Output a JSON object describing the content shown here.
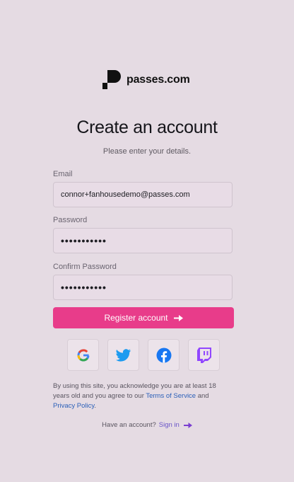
{
  "brand": {
    "name": "passes.com"
  },
  "header": {
    "title": "Create an account",
    "subtitle": "Please enter your details."
  },
  "form": {
    "email": {
      "label": "Email",
      "value": "connor+fanhousedemo@passes.com"
    },
    "password": {
      "label": "Password",
      "value": "•••••••••••"
    },
    "confirm_password": {
      "label": "Confirm Password",
      "value": "•••••••••••"
    },
    "register_label": "Register account"
  },
  "social": {
    "providers": [
      "google-icon",
      "twitter-icon",
      "facebook-icon",
      "twitch-icon"
    ]
  },
  "legal": {
    "prefix": "By using this site, you acknowledge you are at least 18 years old and you agree to our",
    "terms_link": "Terms of Service",
    "and": "and",
    "privacy_link": "Privacy Policy",
    "suffix": "."
  },
  "footer": {
    "prompt": "Have an account?",
    "signin_link": "Sign in"
  },
  "colors": {
    "background": "#e5dbe3",
    "accent": "#e83c8a",
    "link": "#2a5fb8",
    "signin_link": "#6a55c8",
    "twitter": "#1d9bf0",
    "facebook": "#1877f2",
    "twitch": "#9146ff"
  }
}
